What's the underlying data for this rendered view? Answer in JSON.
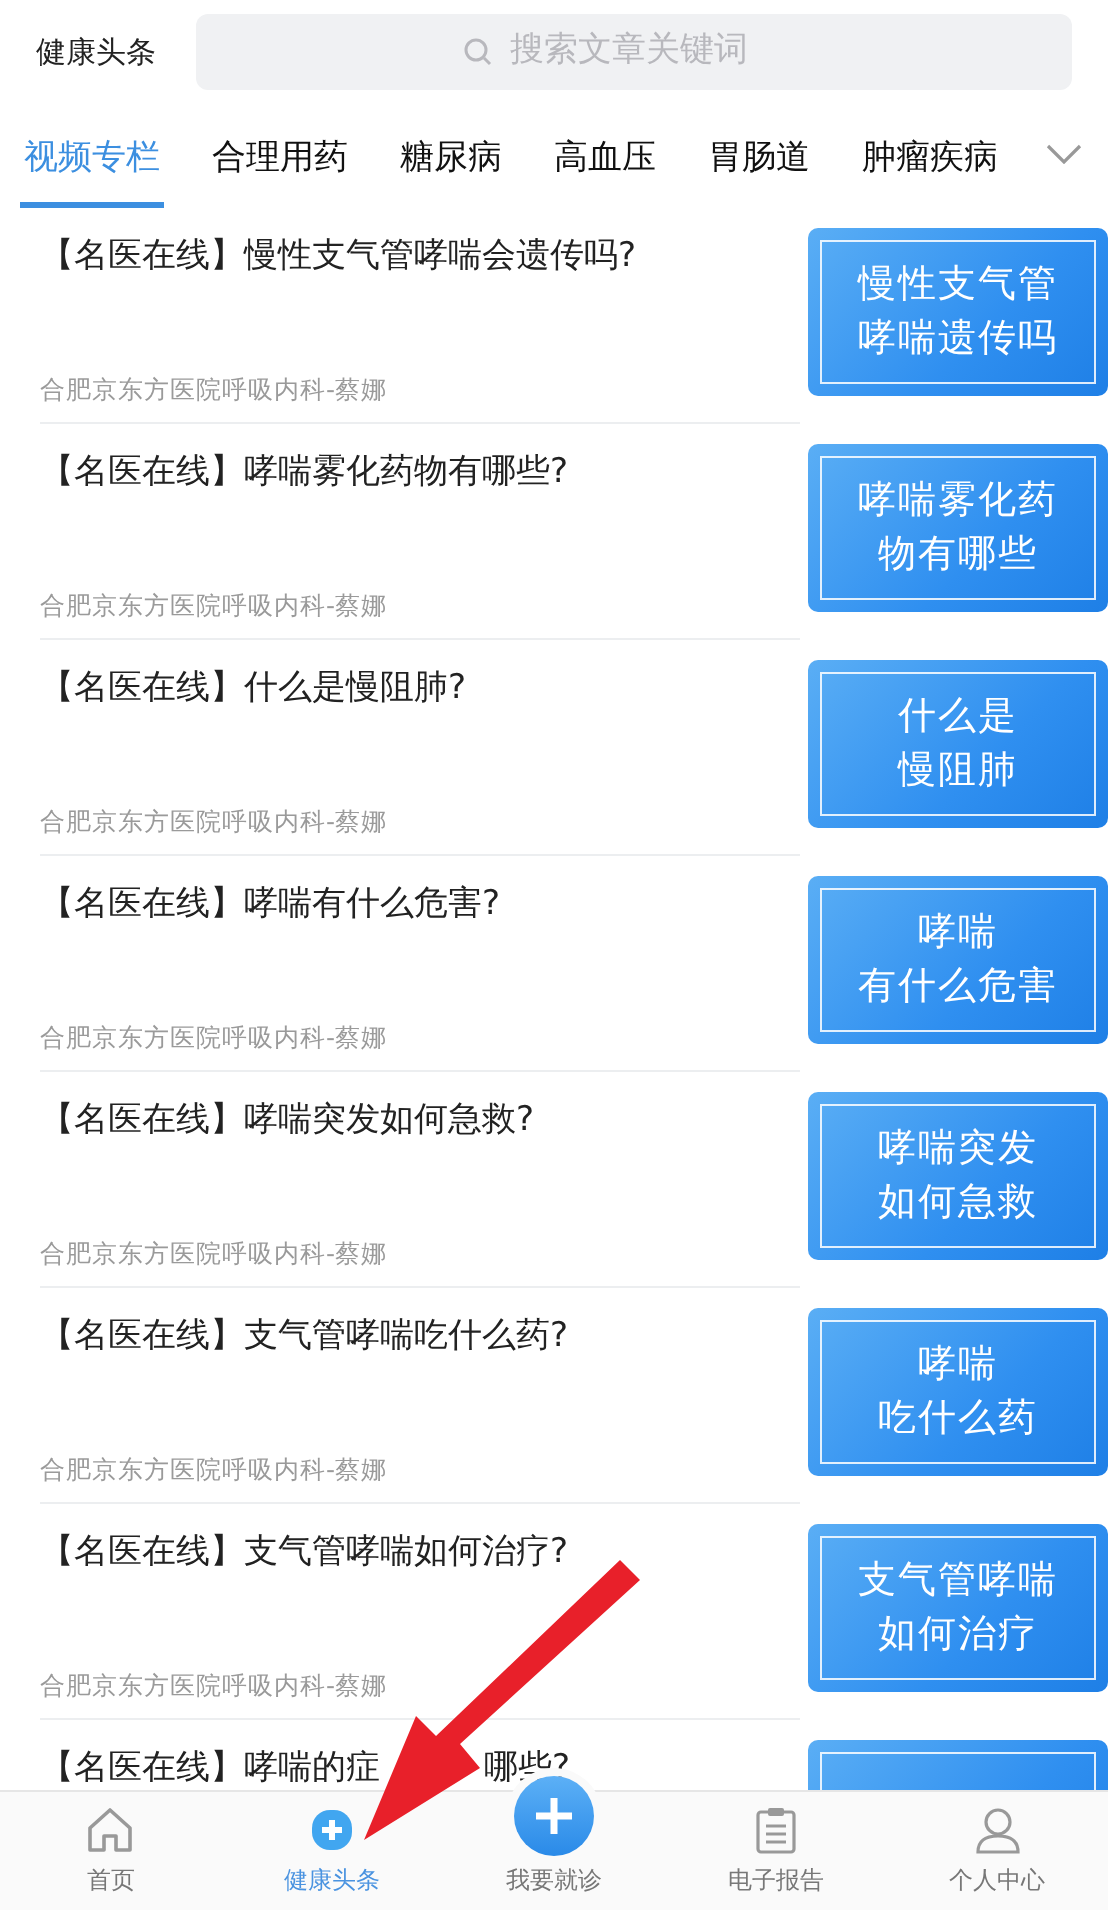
{
  "header": {
    "title": "健康头条",
    "search": {
      "placeholder": "搜索文章关键词"
    }
  },
  "tabs": [
    {
      "label": "视频专栏",
      "selected": true
    },
    {
      "label": "合理用药",
      "selected": false
    },
    {
      "label": "糖尿病",
      "selected": false
    },
    {
      "label": "高血压",
      "selected": false
    },
    {
      "label": "胃肠道",
      "selected": false
    },
    {
      "label": "肿瘤疾病",
      "selected": false
    }
  ],
  "articles": [
    {
      "title": "【名医在线】慢性支气管哮喘会遗传吗?",
      "source": "合肥京东方医院呼吸内科-蔡娜",
      "thumb_lines": [
        "慢性支气管",
        "哮喘遗传吗"
      ]
    },
    {
      "title": "【名医在线】哮喘雾化药物有哪些?",
      "source": "合肥京东方医院呼吸内科-蔡娜",
      "thumb_lines": [
        "哮喘雾化药",
        "物有哪些"
      ]
    },
    {
      "title": "【名医在线】什么是慢阻肺?",
      "source": "合肥京东方医院呼吸内科-蔡娜",
      "thumb_lines": [
        "什么是",
        "慢阻肺"
      ]
    },
    {
      "title": "【名医在线】哮喘有什么危害?",
      "source": "合肥京东方医院呼吸内科-蔡娜",
      "thumb_lines": [
        "哮喘",
        "有什么危害"
      ]
    },
    {
      "title": "【名医在线】哮喘突发如何急救?",
      "source": "合肥京东方医院呼吸内科-蔡娜",
      "thumb_lines": [
        "哮喘突发",
        "如何急救"
      ]
    },
    {
      "title": "【名医在线】支气管哮喘吃什么药?",
      "source": "合肥京东方医院呼吸内科-蔡娜",
      "thumb_lines": [
        "哮喘",
        "吃什么药"
      ]
    },
    {
      "title": "【名医在线】支气管哮喘如何治疗?",
      "source": "合肥京东方医院呼吸内科-蔡娜",
      "thumb_lines": [
        "支气管哮喘",
        "如何治疗"
      ]
    },
    {
      "title": "【名医在线】哮喘的症",
      "title_end": "哪些?"
    }
  ],
  "bottom_nav": [
    {
      "label": "首页",
      "kind": "home",
      "selected": false
    },
    {
      "label": "健康头条",
      "kind": "news",
      "selected": true
    },
    {
      "label": "我要就诊",
      "kind": "visit",
      "selected": false
    },
    {
      "label": "电子报告",
      "kind": "report",
      "selected": false
    },
    {
      "label": "个人中心",
      "kind": "profile",
      "selected": false
    }
  ]
}
